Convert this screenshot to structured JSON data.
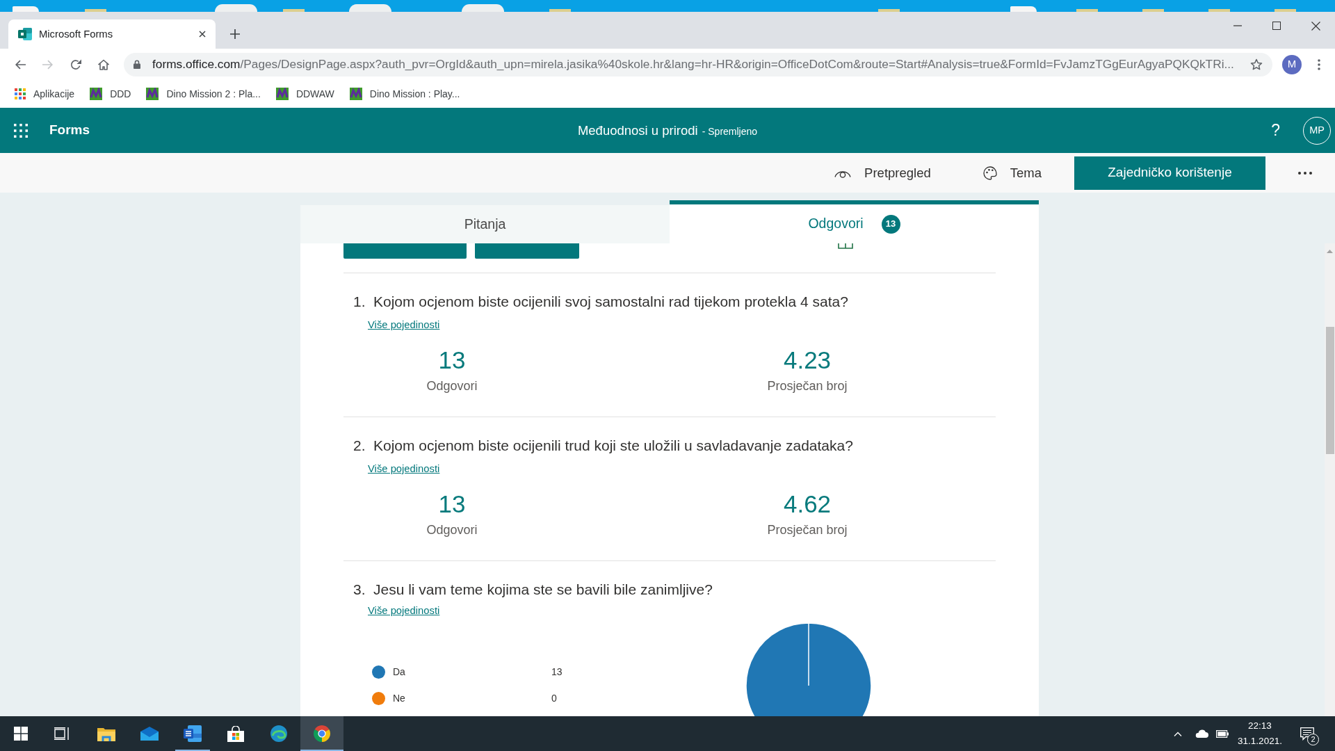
{
  "browser": {
    "tabs": [
      {
        "title": "Microsoft Forms",
        "selected": true
      }
    ],
    "navigation": [
      {
        "kind": "back",
        "disabled": false
      },
      {
        "kind": "forward",
        "disabled": true
      },
      {
        "kind": "reload",
        "disabled": false
      },
      {
        "kind": "home",
        "disabled": false
      }
    ],
    "address": {
      "host": "forms.office.com",
      "path": "/Pages/DesignPage.aspx?auth_pvr=OrgId&auth_upn=mirela.jasika%40skole.hr&lang=hr-HR&origin=OfficeDotCom&route=Start#Analysis=true&FormId=FvJamzTGgEurAgyaPQKQkTRi..."
    },
    "profile_initial": "M",
    "bookmarks": [
      {
        "kind": "apps",
        "label": "Aplikacije"
      },
      {
        "kind": "site",
        "label": "DDD"
      },
      {
        "kind": "site",
        "label": "Dino Mission 2 : Pla..."
      },
      {
        "kind": "site",
        "label": "DDWAW"
      },
      {
        "kind": "site",
        "label": "Dino Mission : Play..."
      }
    ]
  },
  "app_header": {
    "app_name": "Forms",
    "form_title": "Međuodnosi u prirodi",
    "save_status": "- Spremljeno",
    "help": "?",
    "avatar_initials": "MP"
  },
  "command_bar": {
    "actions": [
      {
        "kind": "preview",
        "label": "Pretpregled"
      },
      {
        "kind": "theme",
        "label": "Tema"
      }
    ],
    "share_button": "Zajedničko korištenje"
  },
  "view_tabs": [
    {
      "label": "Pitanja",
      "selected": false
    },
    {
      "label": "Odgovori",
      "selected": true,
      "count": "13"
    }
  ],
  "questions": [
    {
      "number": "1.",
      "text": "Kojom ocjenom biste ocijenili svoj samostalni rad tijekom protekla 4 sata?",
      "details_link": "Više pojedinosti",
      "kind": "rating",
      "stats": [
        {
          "value": "13",
          "label": "Odgovori"
        },
        {
          "value": "4.23",
          "label": "Prosječan broj"
        }
      ]
    },
    {
      "number": "2.",
      "text": "Kojom ocjenom biste ocijenili trud koji ste uložili u savladavanje zadataka?",
      "details_link": "Više pojedinosti",
      "kind": "rating",
      "stats": [
        {
          "value": "13",
          "label": "Odgovori"
        },
        {
          "value": "4.62",
          "label": "Prosječan broj"
        }
      ]
    },
    {
      "number": "3.",
      "text": "Jesu li vam teme kojima ste se bavili bile zanimljive?",
      "details_link": "Više pojedinosti",
      "kind": "choice",
      "legend": [
        {
          "count": "13",
          "color": "#2077b4"
        },
        {
          "count": "0",
          "color": "#f07c0c"
        }
      ],
      "chart_data": {
        "type": "pie",
        "categories": [
          "Da",
          "Ne"
        ],
        "values": [
          100,
          0
        ]
      }
    }
  ],
  "taskbar": {
    "apps": [
      {
        "kind": "start",
        "running": false,
        "selected": false
      },
      {
        "kind": "task-view",
        "running": false,
        "selected": false
      },
      {
        "kind": "folder",
        "running": false,
        "selected": false
      },
      {
        "kind": "mail",
        "running": false,
        "selected": false
      },
      {
        "kind": "word",
        "running": true,
        "selected": false
      },
      {
        "kind": "store",
        "running": false,
        "selected": false
      },
      {
        "kind": "edge",
        "running": false,
        "selected": false
      },
      {
        "kind": "chrome",
        "running": true,
        "selected": true
      }
    ],
    "time": "22:13",
    "date": "31.1.2021.",
    "notification_count": "2"
  }
}
